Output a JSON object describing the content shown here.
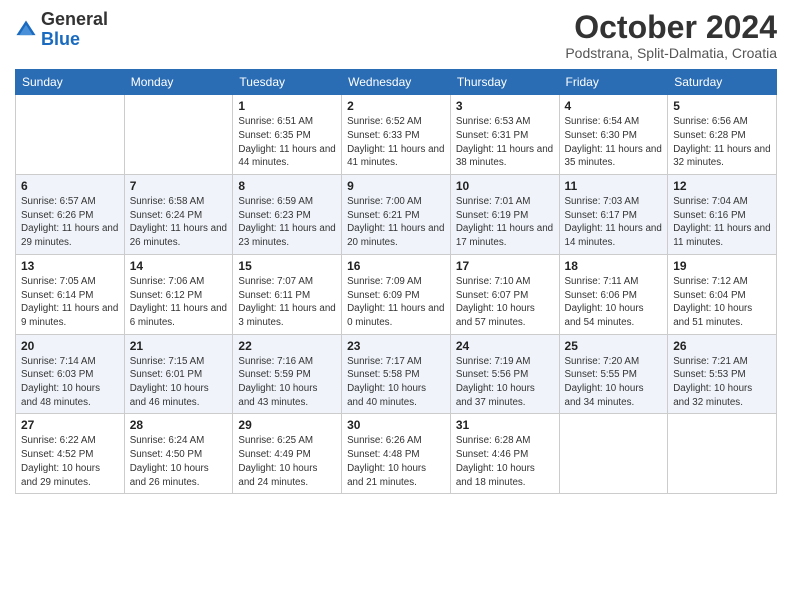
{
  "logo": {
    "general": "General",
    "blue": "Blue"
  },
  "header": {
    "month": "October 2024",
    "location": "Podstrana, Split-Dalmatia, Croatia"
  },
  "columns": [
    "Sunday",
    "Monday",
    "Tuesday",
    "Wednesday",
    "Thursday",
    "Friday",
    "Saturday"
  ],
  "weeks": [
    [
      {
        "day": "",
        "info": ""
      },
      {
        "day": "",
        "info": ""
      },
      {
        "day": "1",
        "info": "Sunrise: 6:51 AM\nSunset: 6:35 PM\nDaylight: 11 hours and 44 minutes."
      },
      {
        "day": "2",
        "info": "Sunrise: 6:52 AM\nSunset: 6:33 PM\nDaylight: 11 hours and 41 minutes."
      },
      {
        "day": "3",
        "info": "Sunrise: 6:53 AM\nSunset: 6:31 PM\nDaylight: 11 hours and 38 minutes."
      },
      {
        "day": "4",
        "info": "Sunrise: 6:54 AM\nSunset: 6:30 PM\nDaylight: 11 hours and 35 minutes."
      },
      {
        "day": "5",
        "info": "Sunrise: 6:56 AM\nSunset: 6:28 PM\nDaylight: 11 hours and 32 minutes."
      }
    ],
    [
      {
        "day": "6",
        "info": "Sunrise: 6:57 AM\nSunset: 6:26 PM\nDaylight: 11 hours and 29 minutes."
      },
      {
        "day": "7",
        "info": "Sunrise: 6:58 AM\nSunset: 6:24 PM\nDaylight: 11 hours and 26 minutes."
      },
      {
        "day": "8",
        "info": "Sunrise: 6:59 AM\nSunset: 6:23 PM\nDaylight: 11 hours and 23 minutes."
      },
      {
        "day": "9",
        "info": "Sunrise: 7:00 AM\nSunset: 6:21 PM\nDaylight: 11 hours and 20 minutes."
      },
      {
        "day": "10",
        "info": "Sunrise: 7:01 AM\nSunset: 6:19 PM\nDaylight: 11 hours and 17 minutes."
      },
      {
        "day": "11",
        "info": "Sunrise: 7:03 AM\nSunset: 6:17 PM\nDaylight: 11 hours and 14 minutes."
      },
      {
        "day": "12",
        "info": "Sunrise: 7:04 AM\nSunset: 6:16 PM\nDaylight: 11 hours and 11 minutes."
      }
    ],
    [
      {
        "day": "13",
        "info": "Sunrise: 7:05 AM\nSunset: 6:14 PM\nDaylight: 11 hours and 9 minutes."
      },
      {
        "day": "14",
        "info": "Sunrise: 7:06 AM\nSunset: 6:12 PM\nDaylight: 11 hours and 6 minutes."
      },
      {
        "day": "15",
        "info": "Sunrise: 7:07 AM\nSunset: 6:11 PM\nDaylight: 11 hours and 3 minutes."
      },
      {
        "day": "16",
        "info": "Sunrise: 7:09 AM\nSunset: 6:09 PM\nDaylight: 11 hours and 0 minutes."
      },
      {
        "day": "17",
        "info": "Sunrise: 7:10 AM\nSunset: 6:07 PM\nDaylight: 10 hours and 57 minutes."
      },
      {
        "day": "18",
        "info": "Sunrise: 7:11 AM\nSunset: 6:06 PM\nDaylight: 10 hours and 54 minutes."
      },
      {
        "day": "19",
        "info": "Sunrise: 7:12 AM\nSunset: 6:04 PM\nDaylight: 10 hours and 51 minutes."
      }
    ],
    [
      {
        "day": "20",
        "info": "Sunrise: 7:14 AM\nSunset: 6:03 PM\nDaylight: 10 hours and 48 minutes."
      },
      {
        "day": "21",
        "info": "Sunrise: 7:15 AM\nSunset: 6:01 PM\nDaylight: 10 hours and 46 minutes."
      },
      {
        "day": "22",
        "info": "Sunrise: 7:16 AM\nSunset: 5:59 PM\nDaylight: 10 hours and 43 minutes."
      },
      {
        "day": "23",
        "info": "Sunrise: 7:17 AM\nSunset: 5:58 PM\nDaylight: 10 hours and 40 minutes."
      },
      {
        "day": "24",
        "info": "Sunrise: 7:19 AM\nSunset: 5:56 PM\nDaylight: 10 hours and 37 minutes."
      },
      {
        "day": "25",
        "info": "Sunrise: 7:20 AM\nSunset: 5:55 PM\nDaylight: 10 hours and 34 minutes."
      },
      {
        "day": "26",
        "info": "Sunrise: 7:21 AM\nSunset: 5:53 PM\nDaylight: 10 hours and 32 minutes."
      }
    ],
    [
      {
        "day": "27",
        "info": "Sunrise: 6:22 AM\nSunset: 4:52 PM\nDaylight: 10 hours and 29 minutes."
      },
      {
        "day": "28",
        "info": "Sunrise: 6:24 AM\nSunset: 4:50 PM\nDaylight: 10 hours and 26 minutes."
      },
      {
        "day": "29",
        "info": "Sunrise: 6:25 AM\nSunset: 4:49 PM\nDaylight: 10 hours and 24 minutes."
      },
      {
        "day": "30",
        "info": "Sunrise: 6:26 AM\nSunset: 4:48 PM\nDaylight: 10 hours and 21 minutes."
      },
      {
        "day": "31",
        "info": "Sunrise: 6:28 AM\nSunset: 4:46 PM\nDaylight: 10 hours and 18 minutes."
      },
      {
        "day": "",
        "info": ""
      },
      {
        "day": "",
        "info": ""
      }
    ]
  ]
}
